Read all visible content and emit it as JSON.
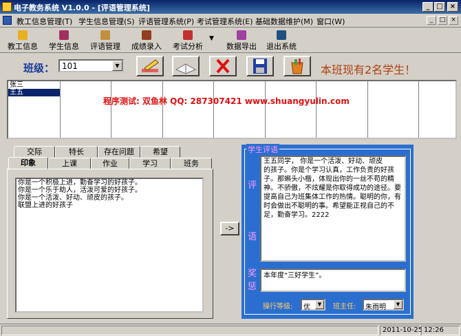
{
  "window": {
    "title": "电子教务系统 V1.0.0 - [评语管理系统]",
    "minimize": "_",
    "maximize": "□",
    "close": "×"
  },
  "menu": {
    "items": [
      "教工信息管理(T)",
      "学生信息管理(S)",
      "评语管理系统(P)",
      "考试管理系统(E)",
      "基础数据维护(M)",
      "窗口(W)"
    ],
    "mdi_minimize": "_",
    "mdi_restore": "□",
    "mdi_close": "×"
  },
  "toolbar": {
    "items": [
      {
        "label": "教工信息",
        "icon": "folder-icon",
        "color": "#e8b020"
      },
      {
        "label": "学生信息",
        "icon": "book-icon",
        "color": "#a03060"
      },
      {
        "label": "评语管理",
        "icon": "notes-icon",
        "color": "#c09040"
      },
      {
        "label": "成绩录入",
        "icon": "pen-icon",
        "color": "#904020"
      },
      {
        "label": "考试分析",
        "icon": "chart-icon",
        "color": "#c03030"
      },
      {
        "label": "数据导出",
        "icon": "export-icon",
        "color": "#a040a0"
      },
      {
        "label": "退出系统",
        "icon": "exit-icon",
        "color": "#205080"
      }
    ],
    "dropdown_arrow": "▼"
  },
  "class_selector": {
    "label": "班级：",
    "value": "101",
    "arrow": "▼"
  },
  "action_buttons": [
    {
      "name": "edit",
      "icon": "pencil-icon",
      "color": "#d04040"
    },
    {
      "name": "open-book",
      "icon": "open-book-icon",
      "color": "#808080"
    },
    {
      "name": "delete",
      "icon": "red-x-icon",
      "color": "#e01010"
    },
    {
      "name": "save",
      "icon": "floppy-disk-icon",
      "color": "#2040a0"
    },
    {
      "name": "clear",
      "icon": "paint-bucket-icon",
      "color": "#e08020"
    }
  ],
  "status_message": "本班现有2名学生！",
  "students": [
    {
      "name": "张三",
      "selected": false
    },
    {
      "name": "王五",
      "selected": true
    }
  ],
  "watermark": "程序测试: 双鱼林  QQ: 287307421  www.shuangyulin.com",
  "tabs": {
    "row1": [
      "交际",
      "特长",
      "存在问题",
      "希望"
    ],
    "row2": [
      "印象",
      "上课",
      "作业",
      "学习",
      "班务"
    ],
    "active": "印象"
  },
  "impression_lines": [
    "你是一个积极上进，勤奋学习的好孩子。",
    "你是一个乐于助人，活泼可爱的好孩子。",
    "你是一个活泼、好动、顽皮的孩子。",
    "联盟上进的好孩子"
  ],
  "transfer_button": "->",
  "comment_panel": {
    "title": "学生评语",
    "comment_label_top": "评",
    "comment_label_bottom": "语",
    "comment_lines": [
      "    王五同学， 你是一个活泼、好动、顽皮",
      "的孩子。你是个学习认真，工作负责的好孩",
      "子。那蝌头小楷，体现出你的一丝不苟的精",
      "神。不骄傲，不炫耀是你取得成功的途径。要",
      "提高自己为班集体工作的热情。聪明的你，有",
      "时会做出不聪明的事。希望能正视自己的不",
      "足，勤奋学习。2222"
    ],
    "award_label_top": "奖",
    "award_label_bottom": "惩",
    "award_text": "本年度“三好学生”。",
    "conduct_label": "操行等级:",
    "conduct_value": "优",
    "teacher_label": "班主任:",
    "teacher_value": "朱雨明",
    "arrow": "▼"
  },
  "statusbar": {
    "date": "2011-10-25",
    "time": "12:26"
  }
}
